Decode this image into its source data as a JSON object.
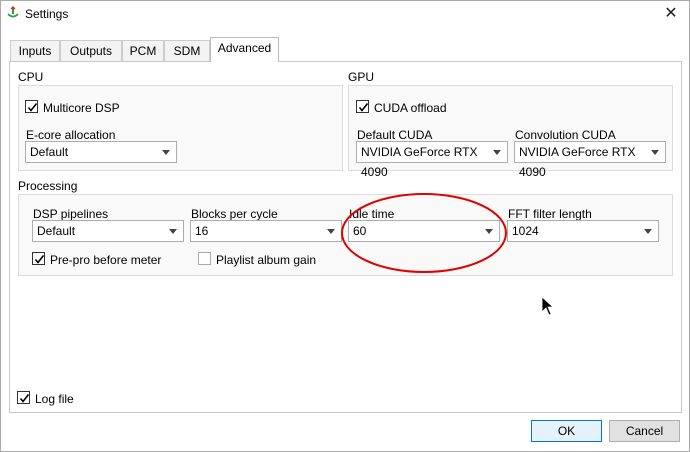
{
  "window": {
    "title": "Settings",
    "close_glyph": "✕"
  },
  "tabs": [
    {
      "label": "Inputs",
      "active": false
    },
    {
      "label": "Outputs",
      "active": false
    },
    {
      "label": "PCM",
      "active": false
    },
    {
      "label": "SDM",
      "active": false
    },
    {
      "label": "Advanced",
      "active": true
    }
  ],
  "cpu": {
    "section_label": "CPU",
    "multicore_label": "Multicore DSP",
    "multicore_checked": true,
    "ecore_label": "E-core allocation",
    "ecore_value": "Default"
  },
  "gpu": {
    "section_label": "GPU",
    "cuda_label": "CUDA offload",
    "cuda_checked": true,
    "default_cuda_label": "Default CUDA",
    "default_cuda_value": "NVIDIA GeForce RTX 4090",
    "convolution_cuda_label": "Convolution CUDA",
    "convolution_cuda_value": "NVIDIA GeForce RTX 4090"
  },
  "processing": {
    "section_label": "Processing",
    "dsp_pipelines_label": "DSP pipelines",
    "dsp_pipelines_value": "Default",
    "blocks_label": "Blocks per cycle",
    "blocks_value": "16",
    "idle_label": "Idle time",
    "idle_value": "60",
    "fft_label": "FFT filter length",
    "fft_value": "1024",
    "prepro_label": "Pre-pro before meter",
    "prepro_checked": true,
    "playlist_label": "Playlist album gain",
    "playlist_checked": false
  },
  "log": {
    "label": "Log file",
    "checked": true
  },
  "buttons": {
    "ok": "OK",
    "cancel": "Cancel"
  },
  "colors": {
    "annotation": "#e00000",
    "default_button_border": "#0078d7"
  }
}
